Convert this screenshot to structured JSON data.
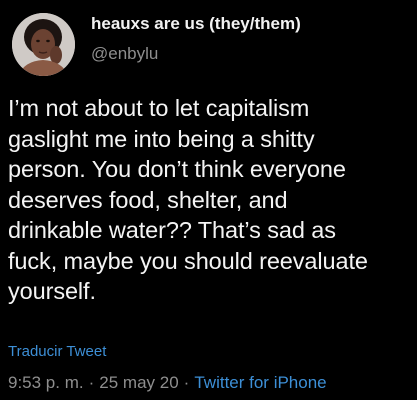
{
  "tweet": {
    "author": {
      "display_name": "heauxs are us (they/them)",
      "handle": "@enbylu",
      "avatar_icon": "profile-photo"
    },
    "text": "I’m not about to let capitalism\ngaslight me into being a shitty\nperson. You don’t think everyone\ndeserves food, shelter, and\ndrinkable water?? That’s sad as\nfuck, maybe you should reevaluate\nyourself.",
    "translate_label": "Traducir Tweet",
    "time": "9:53 p. m.",
    "separator": "·",
    "date": "25 may 20",
    "source": "Twitter for iPhone"
  },
  "colors": {
    "background": "#000000",
    "text": "#f4f4f4",
    "secondary": "#8e8e8e",
    "link": "#3d8fd6"
  }
}
